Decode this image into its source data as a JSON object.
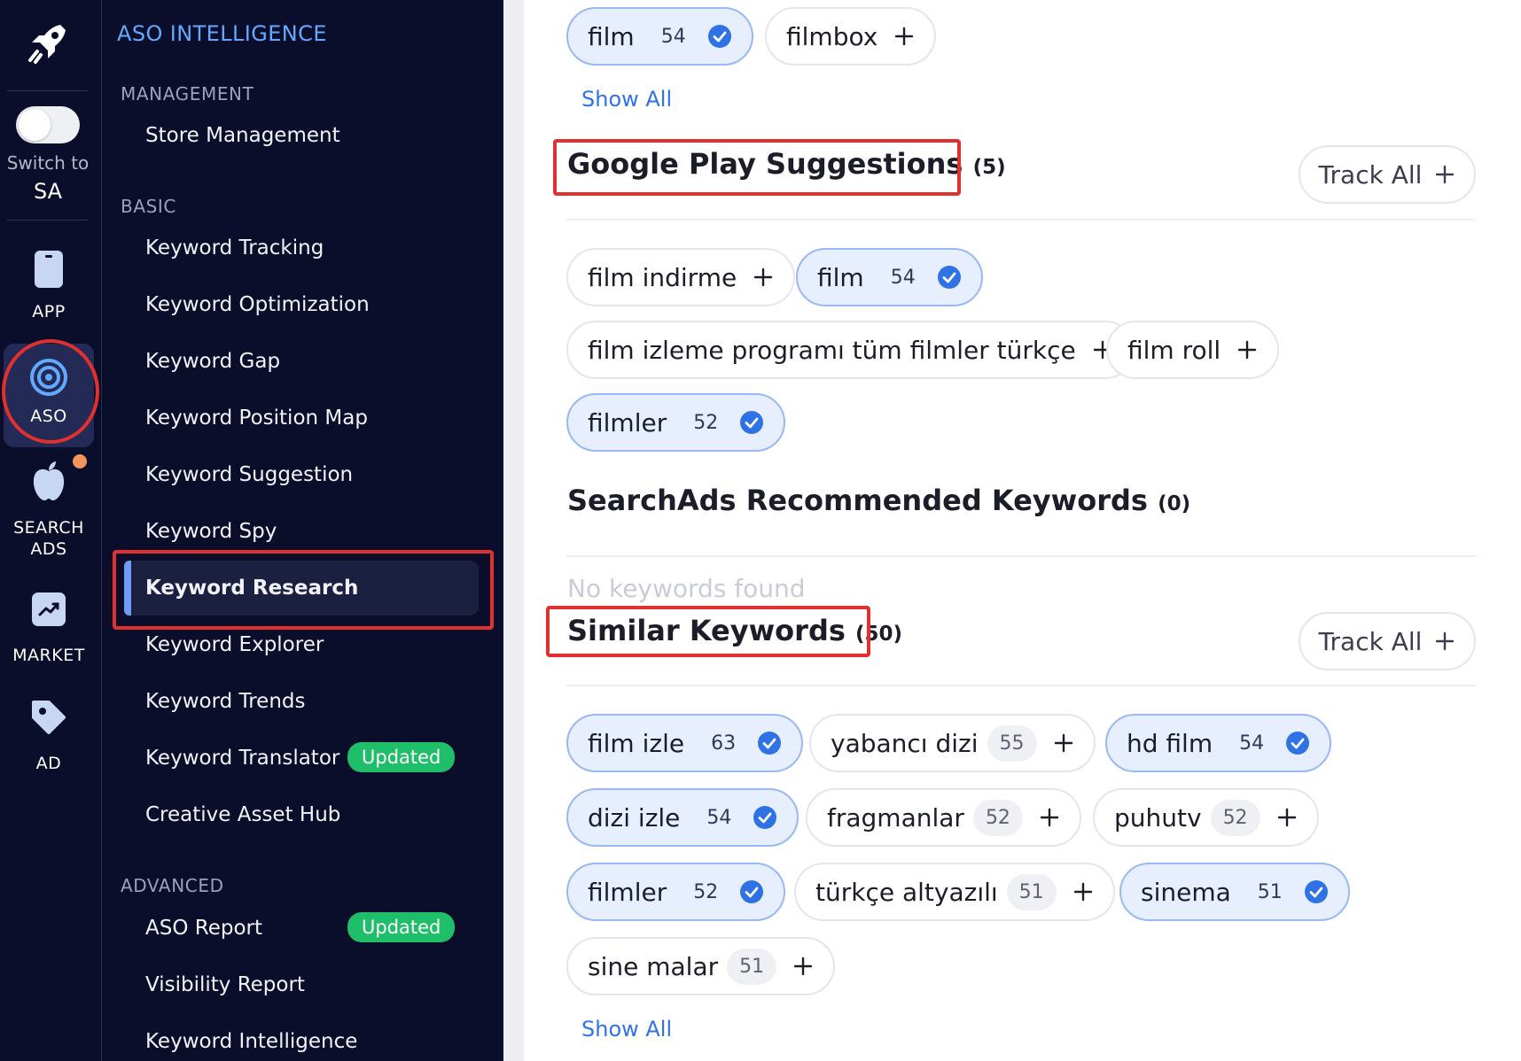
{
  "rail": {
    "switch_label": "Switch to",
    "switch_value": "SA",
    "items": [
      {
        "label": "APP",
        "icon": "phone-icon"
      },
      {
        "label": "ASO",
        "icon": "target-icon"
      },
      {
        "label": "SEARCH ADS",
        "icon": "apple-icon"
      },
      {
        "label": "MARKET",
        "icon": "trend-chart-icon"
      },
      {
        "label": "AD",
        "icon": "tag-icon"
      }
    ]
  },
  "menu": {
    "title": "ASO INTELLIGENCE",
    "sections": {
      "management": "MANAGEMENT",
      "basic": "BASIC",
      "advanced": "ADVANCED"
    },
    "management_items": [
      "Store Management"
    ],
    "basic_items": [
      "Keyword Tracking",
      "Keyword Optimization",
      "Keyword Gap",
      "Keyword Position Map",
      "Keyword Suggestion",
      "Keyword Spy",
      "Keyword Research",
      "Keyword Explorer",
      "Keyword Trends",
      "Keyword Translator",
      "Creative Asset Hub"
    ],
    "advanced_items": [
      "ASO Report",
      "Visibility Report",
      "Keyword Intelligence"
    ],
    "active_item": "Keyword Research",
    "badge": "Updated"
  },
  "content": {
    "top_chips": [
      {
        "text": "film",
        "score": "54",
        "tracked": true
      },
      {
        "text": "filmbox",
        "tracked": false
      }
    ],
    "show_all": "Show All",
    "google_play": {
      "title": "Google Play Suggestions",
      "count": "(5)",
      "track_all": "Track All",
      "chips": [
        {
          "text": "film indirme",
          "tracked": false
        },
        {
          "text": "film",
          "score": "54",
          "tracked": true
        },
        {
          "text": "film izleme programı tüm filmler türkçe",
          "tracked": false
        },
        {
          "text": "film roll",
          "tracked": false
        },
        {
          "text": "filmler",
          "score": "52",
          "tracked": true
        }
      ]
    },
    "searchads": {
      "title": "SearchAds Recommended Keywords",
      "count": "(0)",
      "empty": "No keywords found"
    },
    "similar": {
      "title": "Similar Keywords",
      "count": "(50)",
      "track_all": "Track All",
      "chips": [
        {
          "text": "film izle",
          "score": "63",
          "tracked": true
        },
        {
          "text": "yabancı dizi",
          "score": "55",
          "tracked": false
        },
        {
          "text": "hd film",
          "score": "54",
          "tracked": true
        },
        {
          "text": "dizi izle",
          "score": "54",
          "tracked": true
        },
        {
          "text": "fragmanlar",
          "score": "52",
          "tracked": false
        },
        {
          "text": "puhutv",
          "score": "52",
          "tracked": false
        },
        {
          "text": "filmler",
          "score": "52",
          "tracked": true
        },
        {
          "text": "türkçe altyazılı",
          "score": "51",
          "tracked": false
        },
        {
          "text": "sinema",
          "score": "51",
          "tracked": true
        },
        {
          "text": "sine malar",
          "score": "51",
          "tracked": false
        }
      ]
    }
  },
  "colors": {
    "sidebar_bg": "#0b0e2b",
    "accent_blue": "#2f72e6",
    "highlight_red": "#e0312f",
    "updated_green": "#1fbf6a",
    "tracked_chip_bg": "#e7efff"
  }
}
